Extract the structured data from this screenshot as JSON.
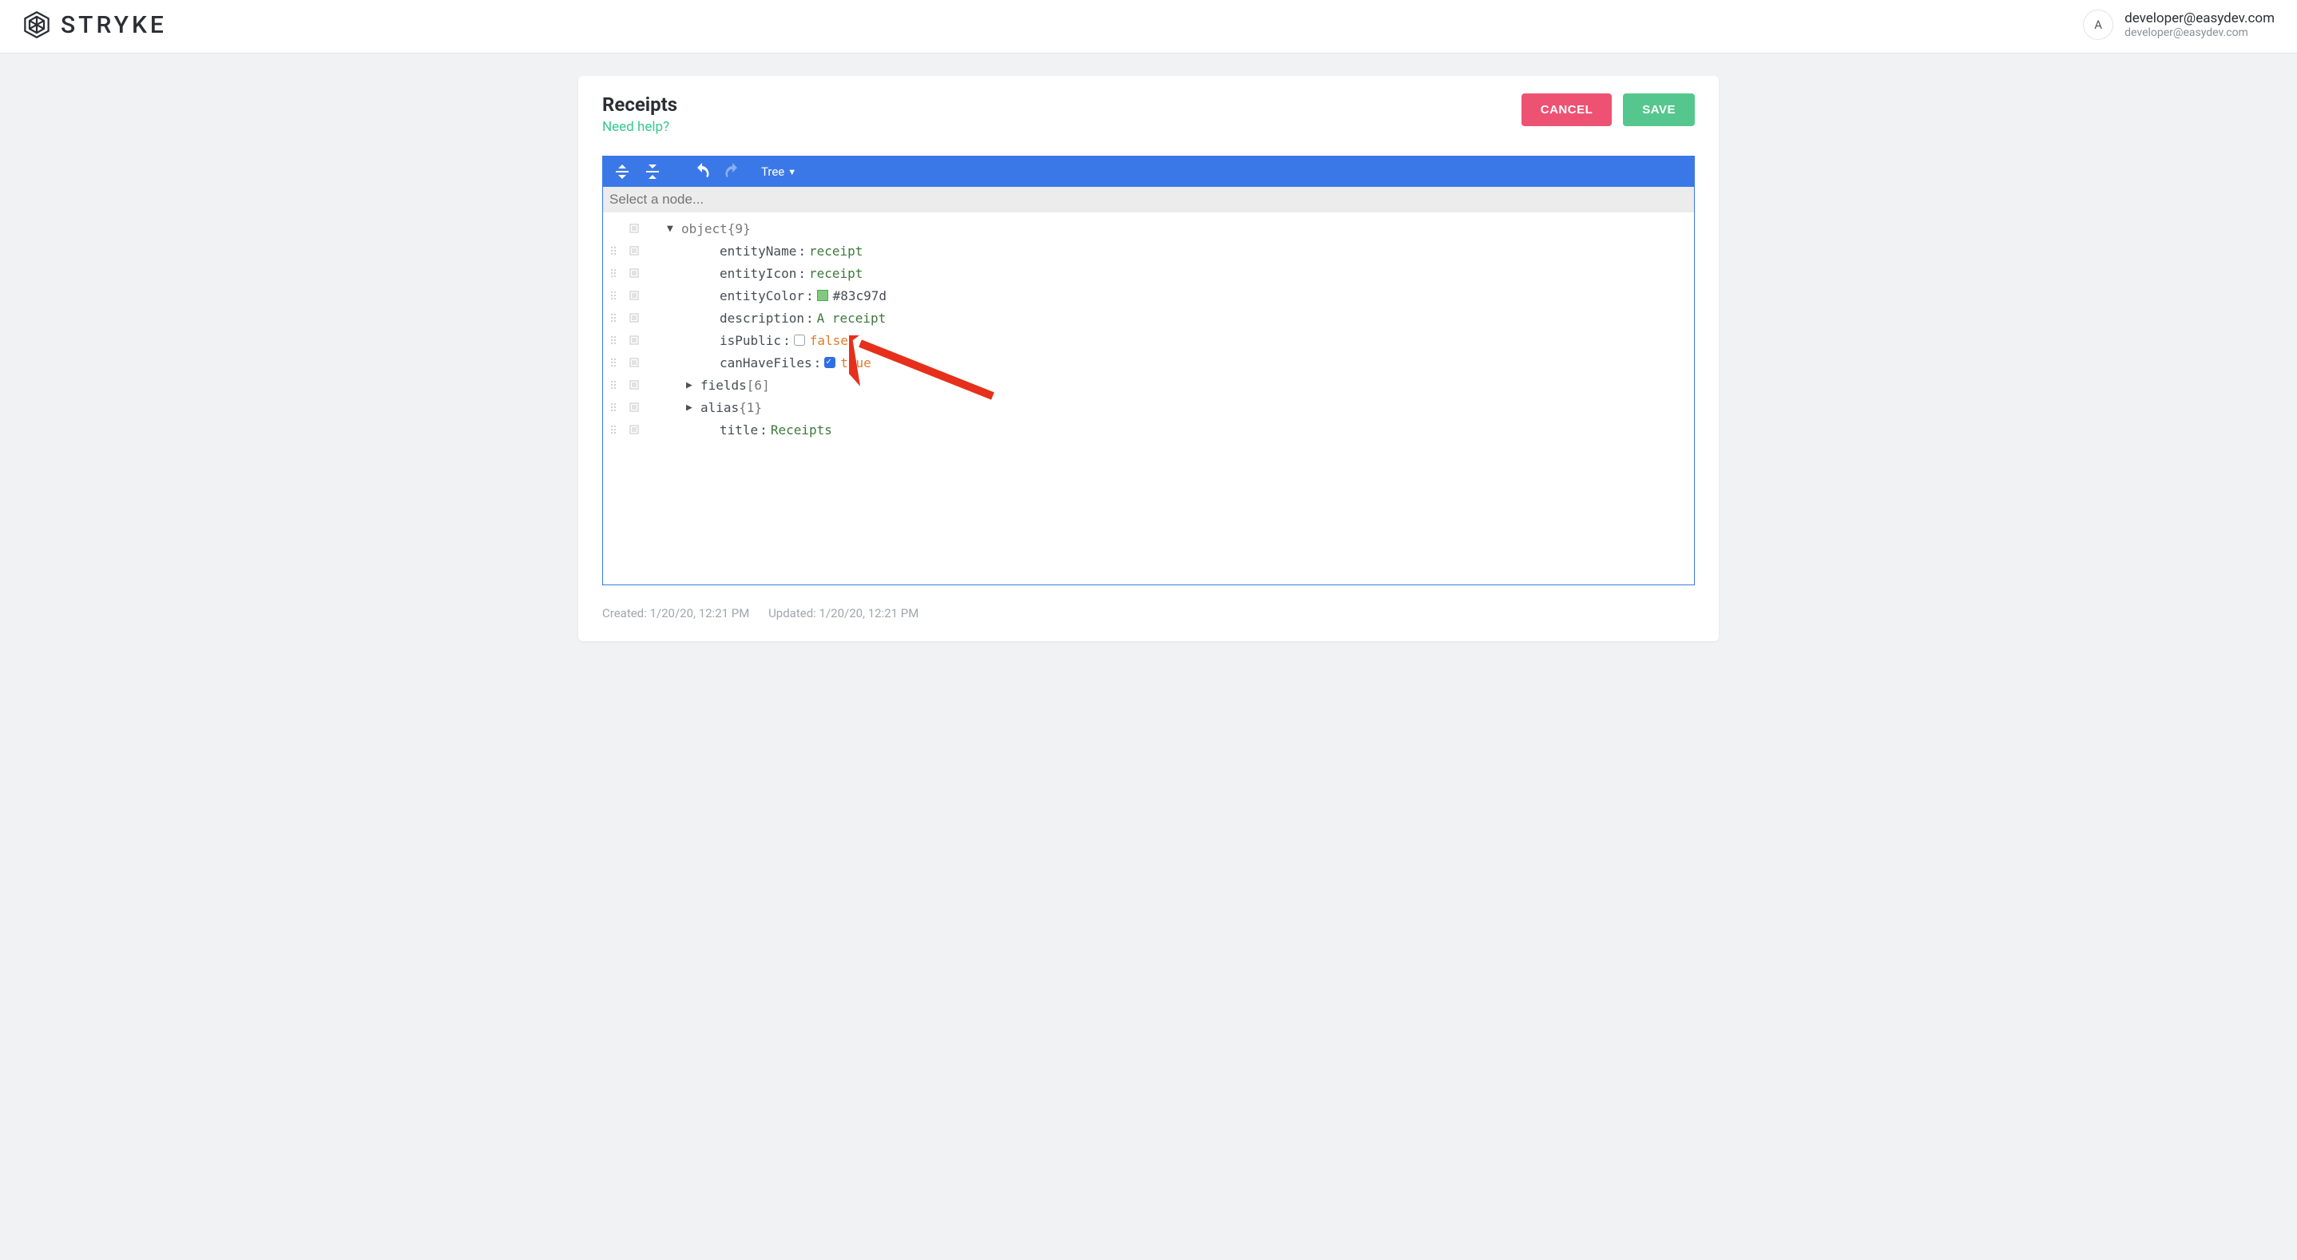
{
  "brand": {
    "name": "STRYKE"
  },
  "user": {
    "avatar_letter": "A",
    "email_main": "developer@easydev.com",
    "email_sub": "developer@easydev.com"
  },
  "page": {
    "title": "Receipts",
    "help_label": "Need help?",
    "cancel_label": "CANCEL",
    "save_label": "SAVE"
  },
  "toolbar": {
    "mode_label": "Tree"
  },
  "search": {
    "placeholder": "Select a node..."
  },
  "tree": {
    "root_type": "object",
    "root_count": "{9}",
    "rows": [
      {
        "key": "entityName",
        "value": "receipt",
        "kind": "string"
      },
      {
        "key": "entityIcon",
        "value": "receipt",
        "kind": "string"
      },
      {
        "key": "entityColor",
        "value": "#83c97d",
        "kind": "color",
        "swatch": "#83c97d"
      },
      {
        "key": "description",
        "value": "A receipt",
        "kind": "string"
      },
      {
        "key": "isPublic",
        "value": "false",
        "kind": "bool",
        "checked": false
      },
      {
        "key": "canHaveFiles",
        "value": "true",
        "kind": "bool",
        "checked": true
      },
      {
        "key": "fields",
        "value": "[6]",
        "kind": "collapsed"
      },
      {
        "key": "alias",
        "value": "{1}",
        "kind": "collapsed"
      },
      {
        "key": "title",
        "value": "Receipts",
        "kind": "string"
      }
    ]
  },
  "timestamps": {
    "created_label": "Created: 1/20/20, 12:21 PM",
    "updated_label": "Updated: 1/20/20, 12:21 PM"
  },
  "annotation": {
    "arrow_color": "#e6301b"
  }
}
